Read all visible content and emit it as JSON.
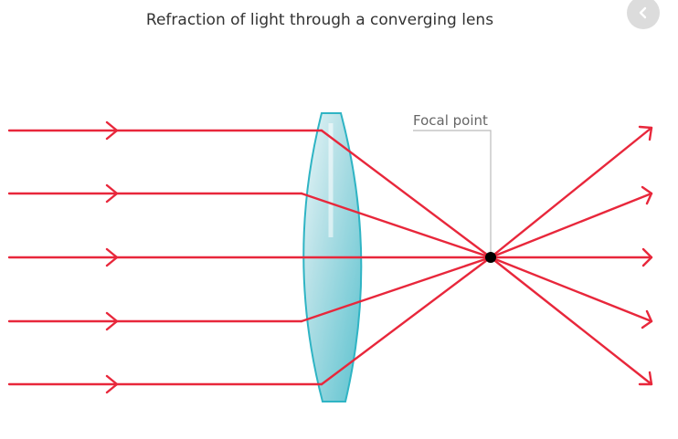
{
  "title": "Refraction of light through a converging lens",
  "focal_label": "Focal point",
  "colors": {
    "ray": "#e8273b",
    "lens_fill": "#a9dbe2",
    "lens_stroke": "#2fb4c4",
    "focal_point": "#000000",
    "leader_line": "#bbbbbb"
  },
  "icons": {
    "back": "chevron-left-icon"
  }
}
